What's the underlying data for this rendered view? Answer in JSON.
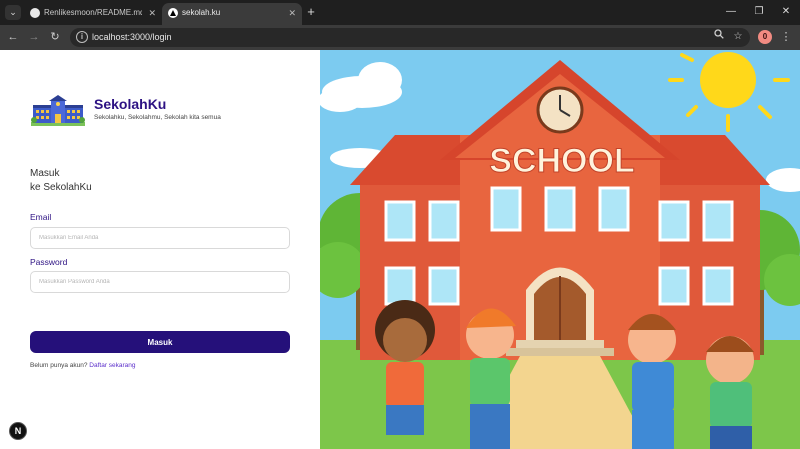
{
  "browser": {
    "tabs": [
      {
        "title": "Renlikesmoon/README.md at ·",
        "active": false
      },
      {
        "title": "sekolah.ku",
        "active": true
      }
    ],
    "new_tab": "+",
    "url": "localhost:3000/login",
    "profile_initial": "0"
  },
  "brand": {
    "name": "SekolahKu",
    "tagline": "Sekolahku, Sekolahmu, Sekolah kita semua"
  },
  "login": {
    "heading_line1": "Masuk",
    "heading_line2": "ke SekolahKu",
    "email_label": "Email",
    "email_placeholder": "Masukkan Email Anda",
    "email_value": "",
    "password_label": "Password",
    "password_placeholder": "Masukkan Password Anda",
    "password_value": "",
    "submit_label": "Masuk",
    "register_prompt": "Belum punya akun?",
    "register_link": "Daftar sekarang"
  },
  "illustration": {
    "sign_text": "SCHOOL"
  },
  "dev_badge": "N",
  "colors": {
    "brand": "#2d1283",
    "button": "#25107a",
    "link": "#5b2ecb"
  }
}
